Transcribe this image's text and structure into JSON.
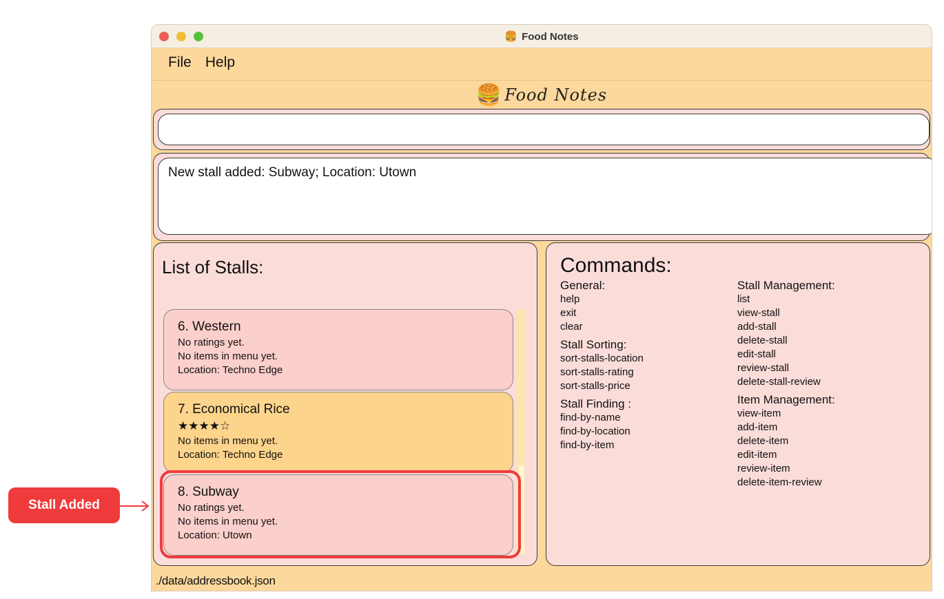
{
  "window": {
    "title": "Food Notes",
    "title_icon": "burger-icon"
  },
  "menu": {
    "file": "File",
    "help": "Help"
  },
  "banner": {
    "logo_text": "Food Notes",
    "logo_icon": "burger-icon"
  },
  "command_box": {
    "value": "",
    "placeholder": ""
  },
  "result": {
    "text": "New stall added: Subway; Location: Utown"
  },
  "stalls": {
    "title": "List of Stalls:",
    "items": [
      {
        "header": "6.  Western",
        "rating": "No ratings yet.",
        "menu": "No items in menu yet.",
        "location": "Location: Techno Edge"
      },
      {
        "header": "7.  Economical Rice",
        "rating": "★★★★☆",
        "menu": "No items in menu yet.",
        "location": "Location: Techno Edge"
      },
      {
        "header": "8.  Subway",
        "rating": "No ratings yet.",
        "menu": "No items in menu yet.",
        "location": "Location: Utown"
      }
    ]
  },
  "commands": {
    "title": "Commands:",
    "general": {
      "heading": "General:",
      "items": [
        "help",
        "exit",
        "clear"
      ]
    },
    "sorting": {
      "heading": "Stall Sorting:",
      "items": [
        "sort-stalls-location",
        "sort-stalls-rating",
        "sort-stalls-price"
      ]
    },
    "finding": {
      "heading": "Stall Finding :",
      "items": [
        "find-by-name",
        "find-by-location",
        "find-by-item"
      ]
    },
    "stall_mgmt": {
      "heading": "Stall Management:",
      "items": [
        "list",
        "view-stall",
        "add-stall",
        "delete-stall",
        "edit-stall",
        "review-stall",
        "delete-stall-review"
      ]
    },
    "item_mgmt": {
      "heading": "Item Management:",
      "items": [
        "view-item",
        "add-item",
        "delete-item",
        "edit-item",
        "review-item",
        "delete-item-review"
      ]
    }
  },
  "status": {
    "path": "./data/addressbook.json"
  },
  "annotation": {
    "label": "Stall Added",
    "color": "#ef3b3b"
  }
}
